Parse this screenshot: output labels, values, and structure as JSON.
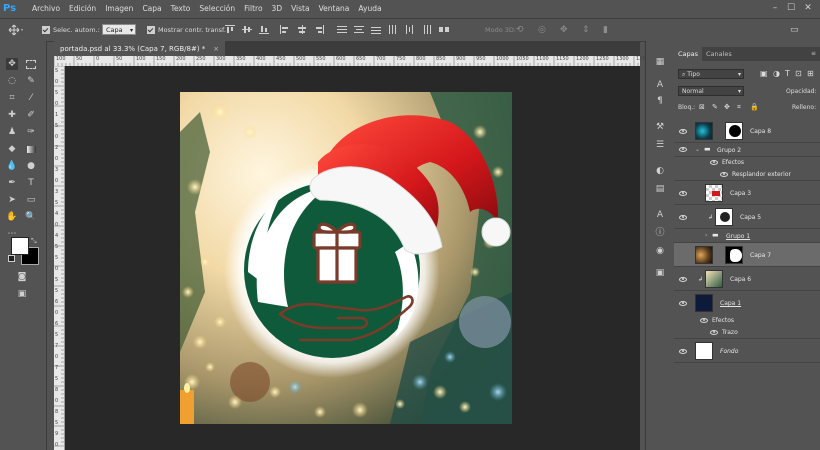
{
  "app": {
    "logo": "Ps"
  },
  "menu": [
    "Archivo",
    "Edición",
    "Imagen",
    "Capa",
    "Texto",
    "Selección",
    "Filtro",
    "3D",
    "Vista",
    "Ventana",
    "Ayuda"
  ],
  "window_controls": {
    "minimize": "–",
    "maximize": "☐",
    "close": "✕"
  },
  "options_bar": {
    "auto_select_label": "Selec. autom.:",
    "auto_select_value": "Capa",
    "show_transform_label": "Mostrar contr. transf.",
    "mode_3d_label": "Modo 3D:"
  },
  "document_tab": {
    "title": "portada.psd al 33.3% (Capa 7, RGB/8#) *",
    "close": "×"
  },
  "ruler_labels": {
    "top": [
      "100",
      "50",
      "0",
      "50",
      "100",
      "150",
      "200",
      "250",
      "300",
      "350",
      "400",
      "450",
      "500",
      "550",
      "600",
      "650",
      "700",
      "750",
      "800",
      "850",
      "900",
      "950",
      "1000",
      "1050",
      "1100",
      "1150",
      "1200",
      "1250",
      "1300",
      "1350",
      "1400",
      "1450"
    ],
    "left": [
      "5",
      "0",
      "5",
      "0",
      "1",
      "5",
      "0",
      "2",
      "0",
      "3",
      "0",
      "3",
      "5",
      "4",
      "0",
      "4",
      "5",
      "5",
      "0",
      "5",
      "5",
      "6",
      "0",
      "6",
      "5",
      "7",
      "0",
      "7",
      "5",
      "8",
      "0",
      "8",
      "5",
      "9",
      "0"
    ]
  },
  "layers_panel": {
    "tabs": [
      "Capas",
      "Canales"
    ],
    "filter_value": "Tipo",
    "blend_mode": "Normal",
    "opacity_label": "Opacidad:",
    "lock_label": "Bloq.:",
    "fill_label": "Relleno:",
    "layers": [
      {
        "name": "Capa 8"
      },
      {
        "name": "Grupo 2"
      },
      {
        "name": "Efectos"
      },
      {
        "name": "Resplandor exterior"
      },
      {
        "name": "Capa 3"
      },
      {
        "name": "Capa 5"
      },
      {
        "name": "Grupo 1"
      },
      {
        "name": "Capa 7"
      },
      {
        "name": "Capa 6"
      },
      {
        "name": "Capa 1"
      },
      {
        "name": "Efectos"
      },
      {
        "name": "Trazo"
      },
      {
        "name": "Fondo"
      }
    ]
  },
  "colors": {
    "ui_bg": "#535353",
    "canvas_bg": "#282828",
    "badge_green": "#0e5a3a",
    "hat_red": "#d4171b",
    "gift_brown": "#7a3b2a",
    "accent_blue": "#31a8ff"
  }
}
